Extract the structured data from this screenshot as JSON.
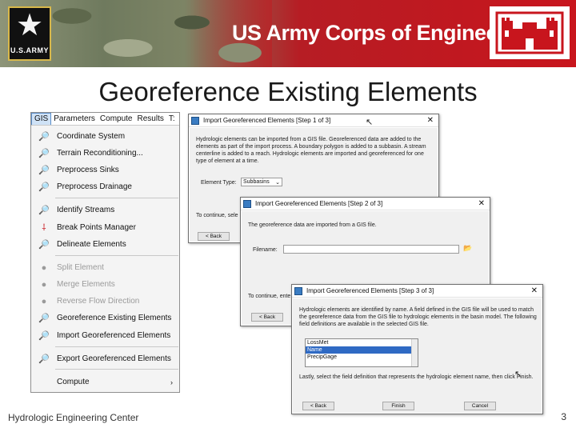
{
  "banner": {
    "organization": "US Army Corps of Engineers",
    "army_logo_text": "U.S.ARMY"
  },
  "slide": {
    "title": "Georeference Existing Elements",
    "footer": "Hydrologic Engineering Center",
    "page_number": "3"
  },
  "menubar": [
    "GIS",
    "Parameters",
    "Compute",
    "Results",
    "T:"
  ],
  "gis_menu": [
    {
      "label": "Coordinate System",
      "enabled": true
    },
    {
      "label": "Terrain Reconditioning...",
      "enabled": true
    },
    {
      "label": "Preprocess Sinks",
      "enabled": true
    },
    {
      "label": "Preprocess Drainage",
      "enabled": true
    },
    {
      "label": "Identify Streams",
      "enabled": true
    },
    {
      "label": "Break Points Manager",
      "enabled": true
    },
    {
      "label": "Delineate Elements",
      "enabled": true
    },
    {
      "label": "Split Element",
      "enabled": false
    },
    {
      "label": "Merge Elements",
      "enabled": false
    },
    {
      "label": "Reverse Flow Direction",
      "enabled": false
    },
    {
      "label": "Georeference Existing Elements",
      "enabled": true
    },
    {
      "label": "Import Georeferenced Elements",
      "enabled": true
    },
    {
      "label": "Export Georeferenced Elements",
      "enabled": true
    },
    {
      "label": "Compute",
      "enabled": true
    }
  ],
  "dialog1": {
    "title": "Import Georeferenced Elements [Step 1 of 3]",
    "description": "Hydrologic elements can be imported from a GIS file. Georeferenced data are added to the elements as part of the import process. A boundary polygon is added to a subbasin. A stream centerline is added to a reach. Hydrologic elements are imported and georeferenced for one type of element at a time.",
    "element_type_label": "Element Type:",
    "element_type_value": "Subbasins",
    "continue_text": "To continue, sele",
    "back_label": "< Back"
  },
  "dialog2": {
    "title": "Import Georeferenced Elements [Step 2 of 3]",
    "description": "The georeference data are imported from a GIS file.",
    "filename_label": "Filename:",
    "filename_value": "",
    "continue_text": "To continue, ente",
    "back_label": "< Back"
  },
  "dialog3": {
    "title": "Import Georeferenced Elements [Step 3 of 3]",
    "description": "Hydrologic elements are identified by name. A field defined in the GIS file will be used to match the georeference data from the GIS file to hydrologic elements in the basin model. The following field definitions are available in the selected GIS file.",
    "fields": [
      "LossMet",
      "Name",
      "PrecipGage"
    ],
    "selected_field": "Name",
    "instruction": "Lastly, select the field definition that represents the hydrologic element name, then click Finish.",
    "back_label": "< Back",
    "finish_label": "Finish",
    "cancel_label": "Cancel"
  },
  "icons": {
    "menu_item": "magnifier-map-icon",
    "break_points": "red-marker-icon"
  }
}
